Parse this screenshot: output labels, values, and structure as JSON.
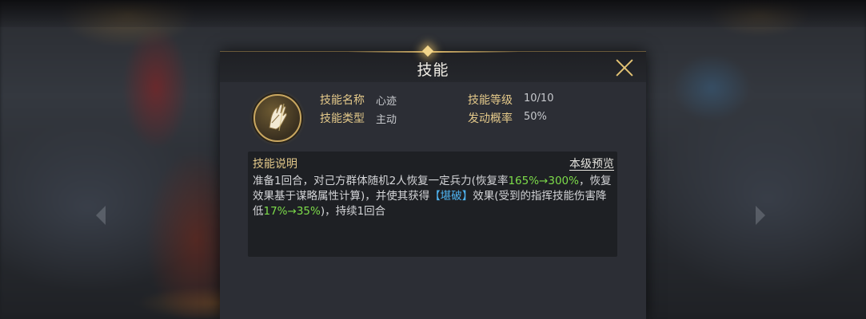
{
  "dialog": {
    "title": "技能",
    "close_icon": "close-icon"
  },
  "skill": {
    "icon": "hand-skill-icon",
    "name_label": "技能名称",
    "name_value": "心迹",
    "type_label": "技能类型",
    "type_value": "主动",
    "level_label": "技能等级",
    "level_value": "10/10",
    "chance_label": "发动概率",
    "chance_value": "50%"
  },
  "description": {
    "title": "技能说明",
    "preview_link": "本级预览",
    "text_1": "准备1回合，对己方群体随机2人恢复一定兵力(恢复率",
    "green_1": "165%→300%",
    "text_2": "，恢复效果基于谋略属性计算)，并使其获得",
    "blue_1": "【堪破】",
    "text_3": "效果(受到的指挥技能伤害降低",
    "green_2": "17%→35%",
    "text_4": ")，持续1回合"
  },
  "colors": {
    "label_gold": "#e4c98a",
    "highlight_green": "#7ddc4a",
    "highlight_blue": "#4fb3f0",
    "close_gold": "#e2c274"
  }
}
